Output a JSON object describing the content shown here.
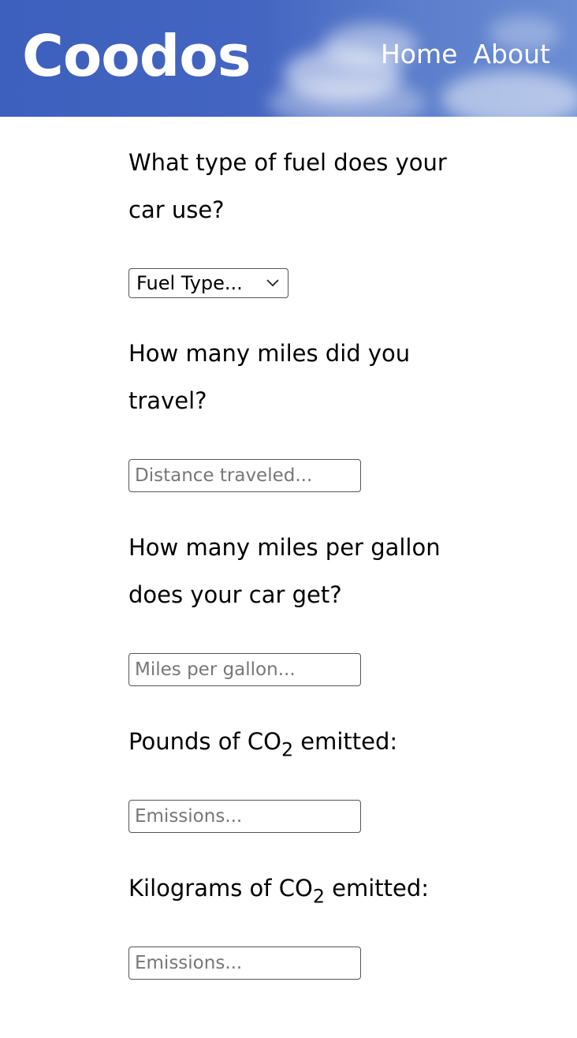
{
  "header": {
    "logo": "Coodos",
    "nav": [
      {
        "label": "Home"
      },
      {
        "label": "About"
      }
    ],
    "colors": {
      "background": "#4466c2",
      "text": "#ffffff"
    }
  },
  "form": {
    "fuel": {
      "question": "What type of fuel does your car use?",
      "select_value": "Fuel Type..."
    },
    "distance": {
      "question": "How many miles did you travel?",
      "placeholder": "Distance traveled..."
    },
    "mpg": {
      "question": "How many miles per gallon does your car get?",
      "placeholder": "Miles per gallon..."
    },
    "pounds": {
      "question_prefix": "Pounds of CO",
      "question_sub": "2",
      "question_suffix": " emitted:",
      "placeholder": "Emissions..."
    },
    "kilograms": {
      "question_prefix": "Kilograms of CO",
      "question_sub": "2",
      "question_suffix": " emitted:",
      "placeholder": "Emissions..."
    }
  }
}
